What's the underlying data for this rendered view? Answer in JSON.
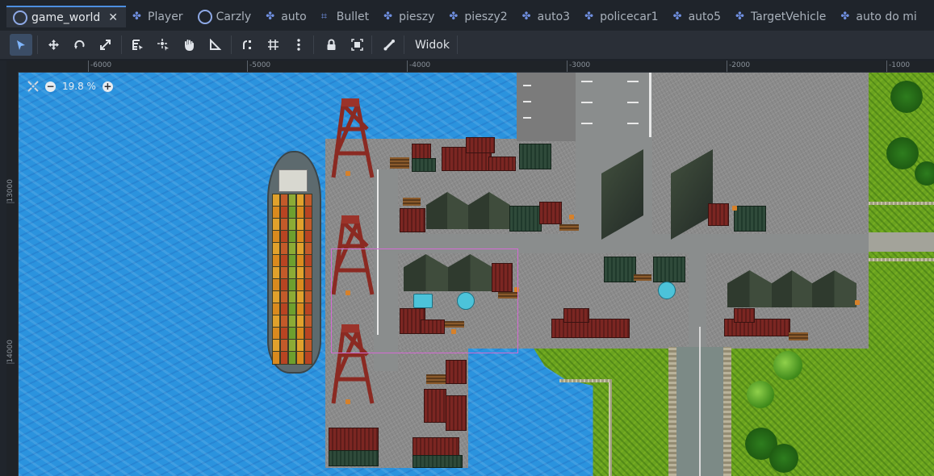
{
  "tabs": [
    {
      "label": "game_world",
      "icon": "ring-icon",
      "active": true
    },
    {
      "label": "Player",
      "icon": "scene-node-icon"
    },
    {
      "label": "Carzly",
      "icon": "ring-icon"
    },
    {
      "label": "auto",
      "icon": "scene-node-icon"
    },
    {
      "label": "Bullet",
      "icon": "area-node-icon"
    },
    {
      "label": "pieszy",
      "icon": "scene-node-icon"
    },
    {
      "label": "pieszy2",
      "icon": "scene-node-icon"
    },
    {
      "label": "auto3",
      "icon": "scene-node-icon"
    },
    {
      "label": "policecar1",
      "icon": "scene-node-icon"
    },
    {
      "label": "auto5",
      "icon": "scene-node-icon"
    },
    {
      "label": "TargetVehicle",
      "icon": "scene-node-icon"
    },
    {
      "label": "auto do mi",
      "icon": "scene-node-icon"
    }
  ],
  "tab_close": "✕",
  "toolbar": {
    "tools": [
      "select-tool-icon",
      "move-tool-icon",
      "rotate-tool-icon",
      "scale-tool-icon",
      "list-select-icon",
      "pivot-icon",
      "pan-icon",
      "ruler-icon",
      "smart-snap-icon",
      "grid-snap-icon",
      "more-icon",
      "lock-icon",
      "group-icon",
      "skeleton-icon"
    ],
    "view_label": "Widok"
  },
  "ruler": {
    "top_labels": [
      "-6000",
      "-5000",
      "-4000",
      "-3000",
      "-2000",
      "-1000"
    ],
    "left_labels": [
      "13000",
      "14000"
    ]
  },
  "zoom": {
    "minus": "−",
    "value": "19.8 %",
    "plus": "+"
  },
  "colors": {
    "accent": "#4d8fe0",
    "water": "#2b93de",
    "grass": "#6aa31f",
    "selection": "#d46bd4"
  }
}
